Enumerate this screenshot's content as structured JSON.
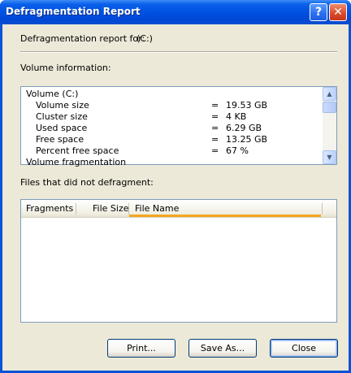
{
  "window": {
    "title": "Defragmentation Report"
  },
  "titlebar": {
    "help_label": "?",
    "close_label": "✕"
  },
  "report": {
    "label": "Defragmentation report for:",
    "drive": "(C:)"
  },
  "volume_info": {
    "label": "Volume information:",
    "rows": [
      {
        "name": "Volume  (C:)",
        "eq": "",
        "value": "",
        "indent": false
      },
      {
        "name": "Volume size",
        "eq": "=",
        "value": "19.53 GB",
        "indent": true
      },
      {
        "name": "Cluster size",
        "eq": "=",
        "value": "4 KB",
        "indent": true
      },
      {
        "name": "Used space",
        "eq": "=",
        "value": "6.29 GB",
        "indent": true
      },
      {
        "name": "Free space",
        "eq": "=",
        "value": "13.25 GB",
        "indent": true
      },
      {
        "name": "Percent free space",
        "eq": "=",
        "value": "67 %",
        "indent": true
      },
      {
        "name": "Volume fragmentation",
        "eq": "",
        "value": "",
        "indent": false
      }
    ]
  },
  "files": {
    "label": "Files that did not defragment:",
    "columns": [
      "Fragments",
      "File Size",
      "File Name"
    ],
    "rows": []
  },
  "buttons": {
    "print": "Print...",
    "save_as": "Save As...",
    "close": "Close"
  },
  "icons": {
    "scroll_up": "▲",
    "scroll_down": "▼"
  },
  "colors": {
    "titlebar": "#0052e0",
    "client": "#ece9d8",
    "accent": "#f5a623"
  }
}
